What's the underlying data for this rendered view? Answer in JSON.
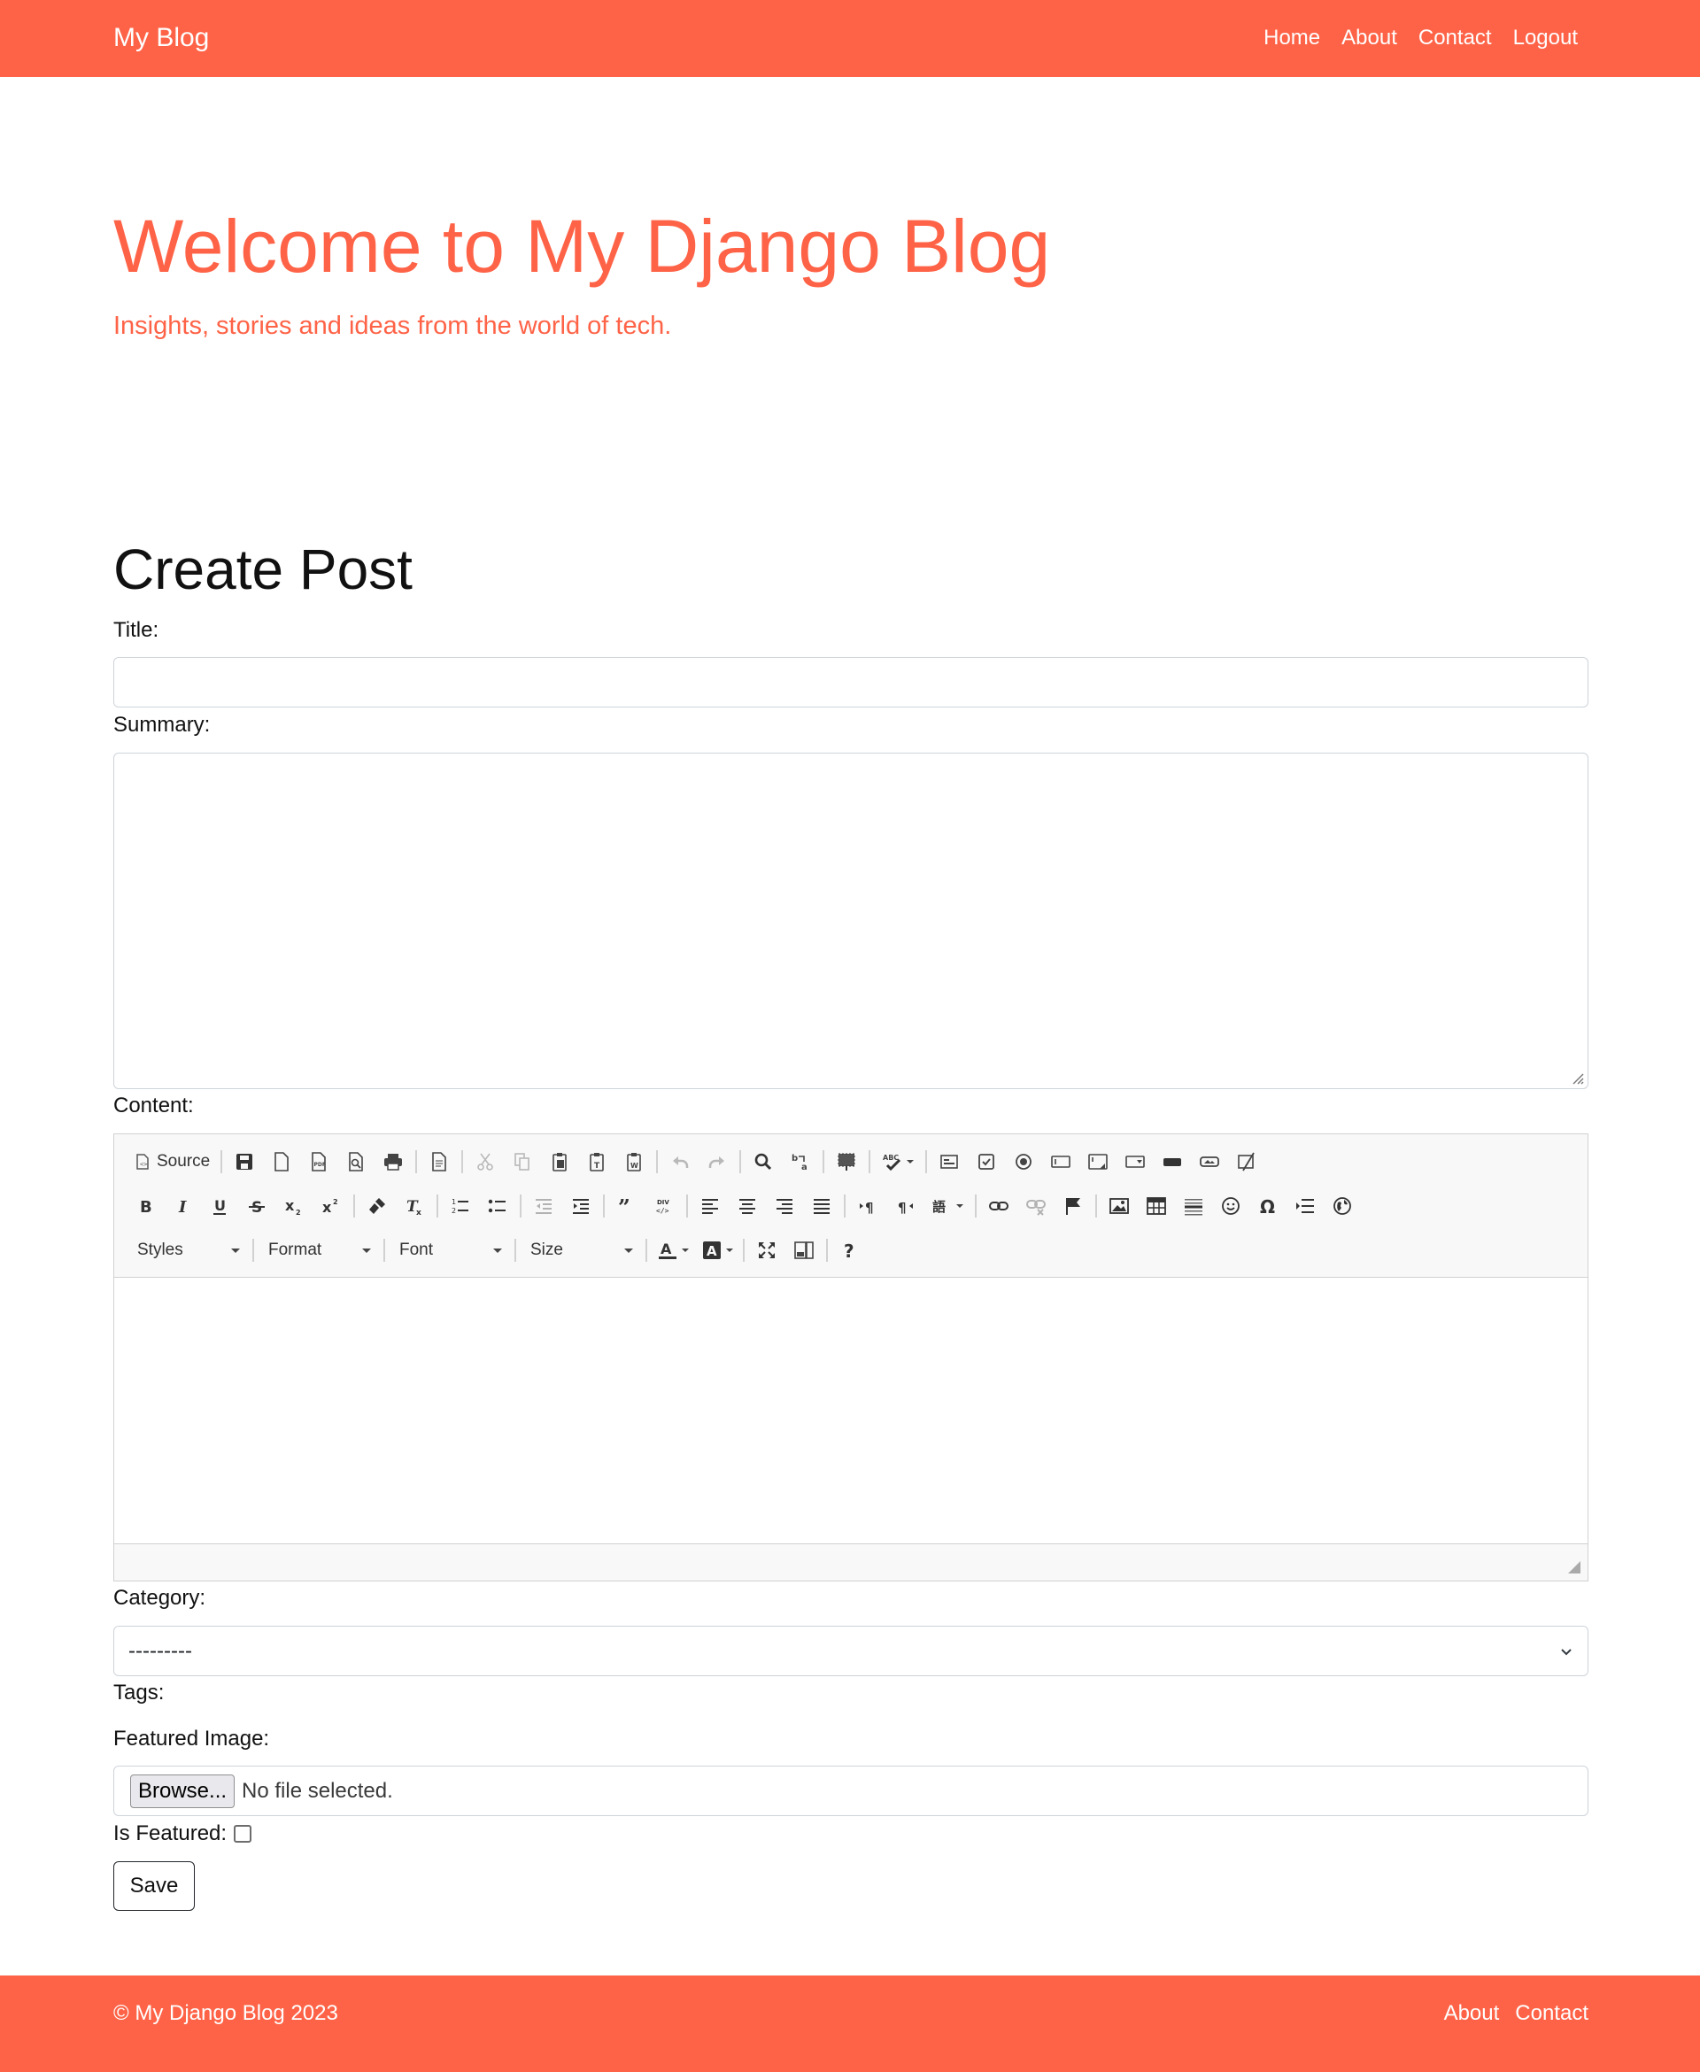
{
  "nav": {
    "brand": "My Blog",
    "links": [
      "Home",
      "About",
      "Contact",
      "Logout"
    ]
  },
  "hero": {
    "title": "Welcome to My Django Blog",
    "subtitle": "Insights, stories and ideas from the world of tech."
  },
  "form": {
    "heading": "Create Post",
    "title_label": "Title:",
    "title_value": "",
    "summary_label": "Summary:",
    "summary_value": "",
    "content_label": "Content:",
    "editor": {
      "source_label": "Source",
      "combos": [
        "Styles",
        "Format",
        "Font",
        "Size"
      ]
    },
    "category_label": "Category:",
    "category_selected": "---------",
    "tags_label": "Tags:",
    "image_label": "Featured Image:",
    "browse_label": "Browse...",
    "file_status": "No file selected.",
    "featured_label": "Is Featured:",
    "featured_checked": false,
    "save_label": "Save"
  },
  "footer": {
    "copyright": "© My Django Blog 2023",
    "links": [
      "About",
      "Contact"
    ]
  },
  "colors": {
    "brand": "#ff6347",
    "text": "#212529",
    "toolbar_bg": "#f8f8f8"
  }
}
